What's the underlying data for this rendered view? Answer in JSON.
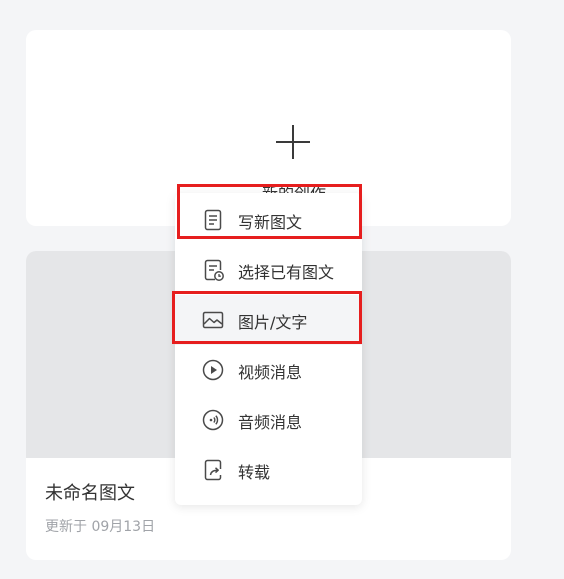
{
  "new_creation": {
    "label": "新的创作",
    "icon": "plus-icon"
  },
  "draft": {
    "title": "未命名图文",
    "meta": "更新于 09月13日"
  },
  "menu": {
    "items": [
      {
        "label": "写新图文",
        "icon": "document-icon"
      },
      {
        "label": "选择已有图文",
        "icon": "document-clock-icon"
      },
      {
        "label": "图片/文字",
        "icon": "image-icon"
      },
      {
        "label": "视频消息",
        "icon": "play-circle-icon"
      },
      {
        "label": "音频消息",
        "icon": "audio-circle-icon"
      },
      {
        "label": "转载",
        "icon": "share-document-icon"
      }
    ]
  },
  "colors": {
    "background": "#f4f5f7",
    "card": "#ffffff",
    "thumbnail": "#e5e6e8",
    "text": "#333333",
    "muted_text": "#a0a3a8",
    "annotation_box": "#e61e1e",
    "menu_hover": "#f4f5f7"
  }
}
